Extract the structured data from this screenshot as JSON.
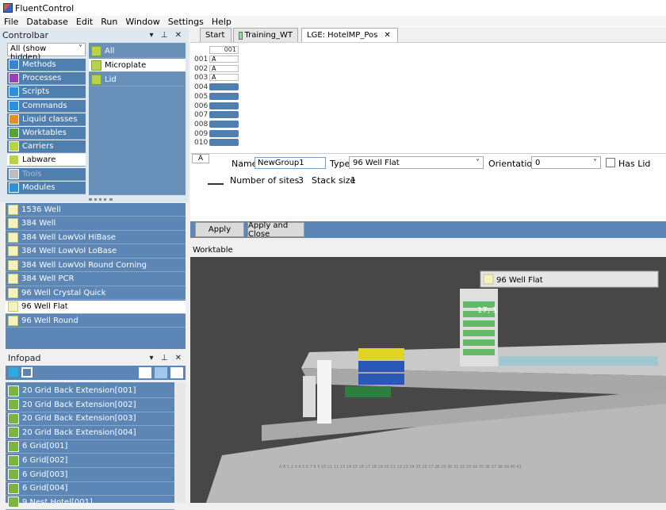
{
  "window": {
    "title": "FluentControl"
  },
  "menu": [
    "File",
    "Database",
    "Edit",
    "Run",
    "Window",
    "Settings",
    "Help"
  ],
  "controlbar": {
    "title": "Controlbar",
    "filter": "All (show hidden)",
    "categories": [
      {
        "label": "Methods",
        "color": "#3c82c8"
      },
      {
        "label": "Processes",
        "color": "#9c3fb5"
      },
      {
        "label": "Scripts",
        "color": "#2f8fd9"
      },
      {
        "label": "Commands",
        "color": "#2f8fd9"
      },
      {
        "label": "Liquid classes",
        "color": "#e0902b"
      },
      {
        "label": "Worktables",
        "color": "#5aa13c"
      },
      {
        "label": "Carriers",
        "color": "#b8d34a"
      },
      {
        "label": "Labware",
        "color": "#b8d34a"
      },
      {
        "label": "Tools",
        "color": "#bdbdbd"
      },
      {
        "label": "Modules",
        "color": "#2f8fd9"
      }
    ],
    "filters": [
      "All",
      "Microplate",
      "Lid"
    ],
    "labware": [
      "1536 Well",
      "384 Well",
      "384 Well LowVol HiBase",
      "384 Well LowVol LoBase",
      "384 Well LowVol Round Corning",
      "384 Well PCR",
      "96 Well Crystal Quick",
      "96 Well Flat",
      "96 Well Round"
    ]
  },
  "infopad": {
    "title": "Infopad",
    "items": [
      "20 Grid Back Extension[001]",
      "20 Grid Back Extension[002]",
      "20 Grid Back Extension[003]",
      "20 Grid Back Extension[004]",
      "6 Grid[001]",
      "6 Grid[002]",
      "6 Grid[003]",
      "6 Grid[004]",
      "9 Nest Hotel[001]"
    ]
  },
  "tabs": [
    {
      "label": "Start"
    },
    {
      "label": "Training_WT"
    },
    {
      "label": "LGE: HotelMP_Pos"
    }
  ],
  "editor": {
    "column": "001",
    "rows": [
      "001",
      "002",
      "003",
      "004",
      "005",
      "006",
      "007",
      "008",
      "009",
      "010"
    ],
    "row_values": [
      "A",
      "A",
      "A"
    ],
    "strip_label": "A"
  },
  "props": {
    "name_label": "Name",
    "name_value": "NewGroup1",
    "type_label": "Type",
    "type_value": "96 Well Flat",
    "orientation_label": "Orientation",
    "orientation_value": "0",
    "has_lid_label": "Has Lid",
    "sites_label": "Number of sites",
    "sites_value": "3",
    "stack_label": "Stack size",
    "stack_value": "1"
  },
  "buttons": {
    "apply": "Apply",
    "apply_close": "Apply and Close"
  },
  "worktable": {
    "title": "Worktable",
    "tooltip": "96 Well Flat",
    "position": "17, 1",
    "ruler": "A B 1 2 3 4 5 6 7 8 9 10 11 12 13 14 15 16 17 18 19 20 21 22 23 24 25 26 27 28 29 30 31 32 33 34 35 36 37 38 39 40 41"
  }
}
